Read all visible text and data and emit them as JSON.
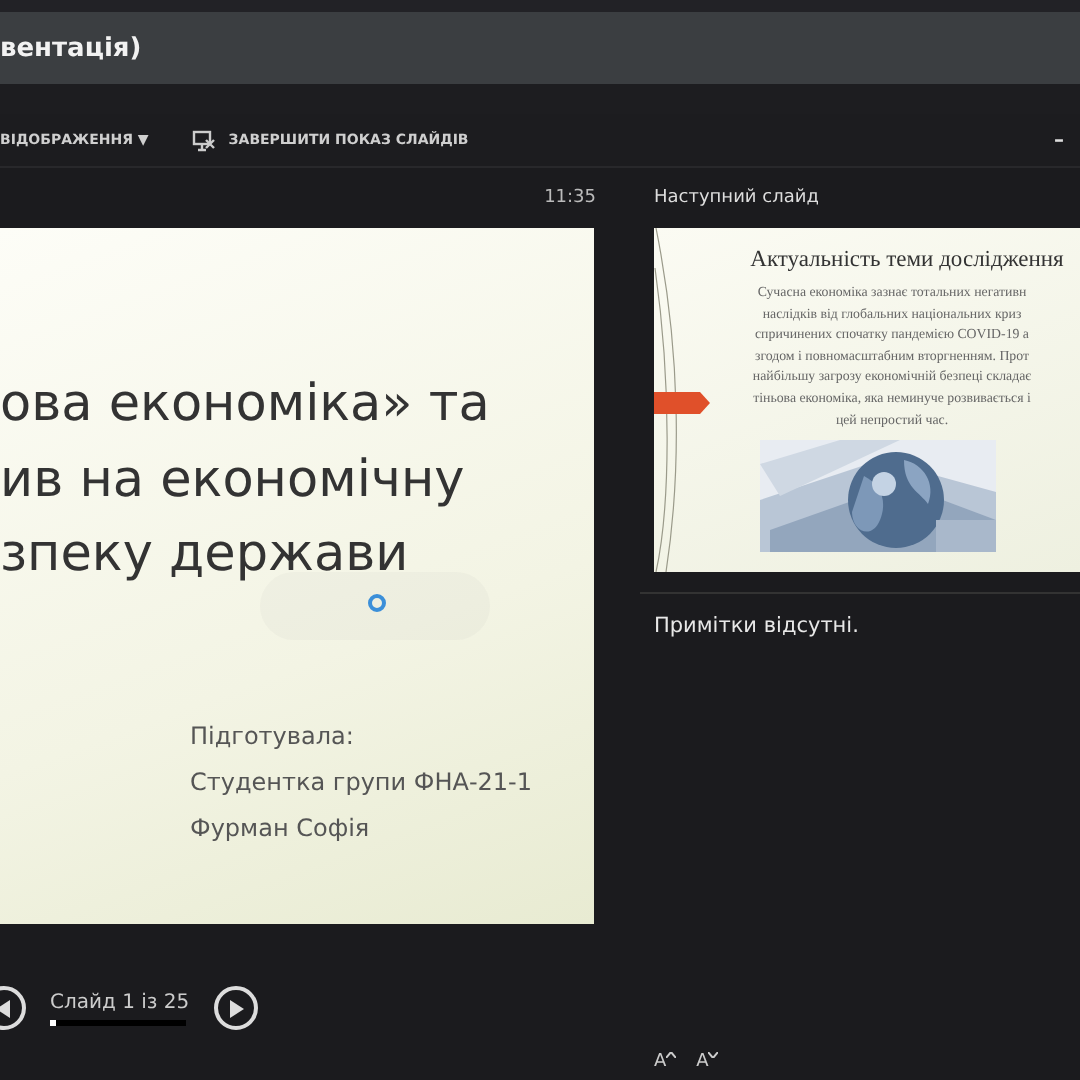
{
  "window": {
    "title": "вентація)",
    "minimize": "–"
  },
  "toolbar": [
    {
      "label": "ВІДОБРАЖЕННЯ ▼",
      "kind": "menu"
    },
    {
      "label": "ЗАВЕРШИТИ ПОКАЗ СЛАЙДІВ",
      "kind": "end"
    }
  ],
  "current_slide": {
    "clock": "11:35",
    "title_lines": [
      "ова економіка» та",
      "ив на економічну",
      "зпеку держави"
    ],
    "subtitle_lines": [
      "Підготувала:",
      "Студентка групи ФНА-21-1",
      "Фурман Софія"
    ]
  },
  "navigation": {
    "counter": "Слайд 1 із 25",
    "level": 0.04
  },
  "next_slide": {
    "heading": "Наступний слайд",
    "title": "Актуальність теми дослідження",
    "body_lines": [
      "Сучасна економіка зазнає тотальних негативн",
      "наслідків від глобальних національних криз",
      "спричинених спочатку пандемією COVID-19 а",
      "згодом і повномасштабним вторгненням. Прот",
      "найбільшу загрозу економічній безпеці складає",
      "тіньова економіка, яка неминуче розвивається і",
      "цей непростий час."
    ]
  },
  "notes": {
    "text": "Примітки відсутні."
  },
  "zoom_buttons": [
    {
      "label": "A",
      "kind": "grow"
    },
    {
      "label": "A",
      "kind": "shrink"
    }
  ]
}
